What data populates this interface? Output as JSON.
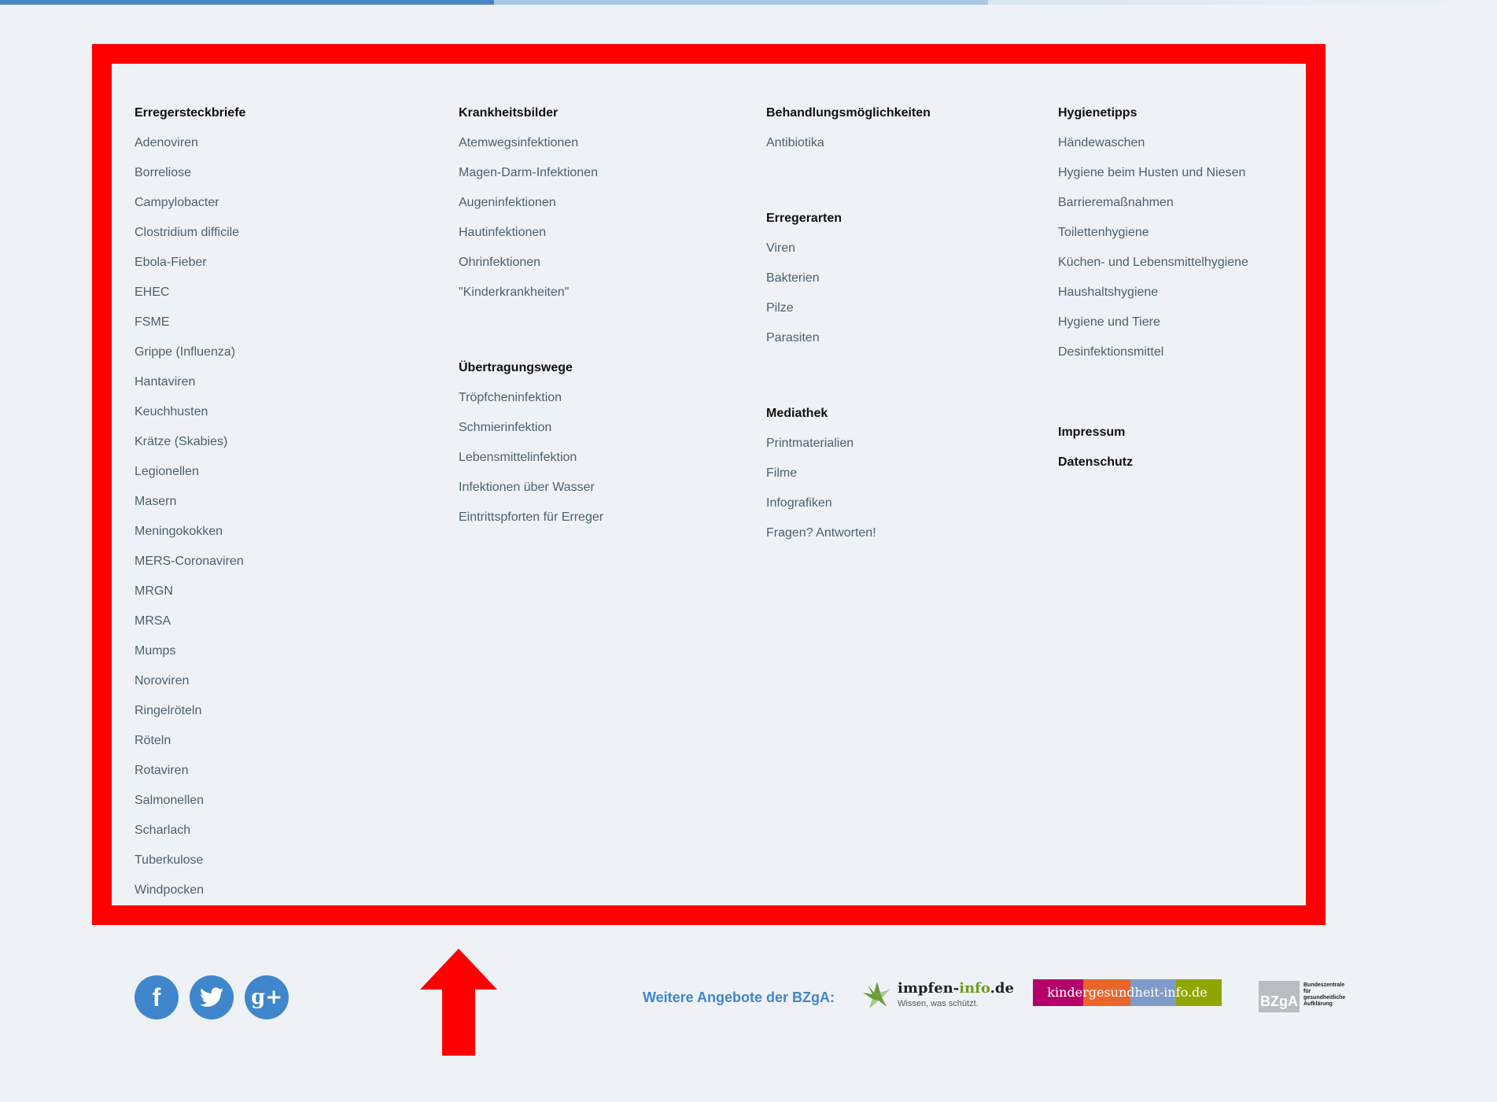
{
  "columns": [
    {
      "sections": [
        {
          "heading": "Erregersteckbriefe",
          "links": [
            "Adenoviren",
            "Borreliose",
            "Campylobacter",
            "Clostridium difficile",
            "Ebola-Fieber",
            "EHEC",
            "FSME",
            "Grippe (Influenza)",
            "Hantaviren",
            "Keuchhusten",
            "Krätze (Skabies)",
            "Legionellen",
            "Masern",
            "Meningokokken",
            "MERS-Coronaviren",
            "MRGN",
            "MRSA",
            "Mumps",
            "Noroviren",
            "Ringelröteln",
            "Röteln",
            "Rotaviren",
            "Salmonellen",
            "Scharlach",
            "Tuberkulose",
            "Windpocken"
          ]
        }
      ]
    },
    {
      "sections": [
        {
          "heading": "Krankheitsbilder",
          "links": [
            "Atemwegsinfektionen",
            "Magen-Darm-Infektionen",
            "Augeninfektionen",
            "Hautinfektionen",
            "Ohrinfektionen",
            "\"Kinderkrankheiten\""
          ]
        },
        {
          "heading": "Übertragungswege",
          "links": [
            "Tröpfcheninfektion",
            "Schmierinfektion",
            "Lebensmittelinfektion",
            "Infektionen über Wasser",
            "Eintrittspforten für Erreger"
          ]
        }
      ]
    },
    {
      "sections": [
        {
          "heading": "Behandlungsmöglichkeiten",
          "links": [
            "Antibiotika"
          ]
        },
        {
          "heading": "Erregerarten",
          "links": [
            "Viren",
            "Bakterien",
            "Pilze",
            "Parasiten"
          ]
        },
        {
          "heading": "Mediathek",
          "links": [
            "Printmaterialien",
            "Filme",
            "Infografiken",
            "Fragen? Antworten!"
          ]
        }
      ]
    },
    {
      "sections": [
        {
          "heading": "Hygienetipps",
          "links": [
            "Händewaschen",
            "Hygiene beim Husten und Niesen",
            "Barrieremaßnahmen",
            "Toilettenhygiene",
            "Küchen- und Lebensmittelhygiene",
            "Haushaltshygiene",
            "Hygiene und Tiere",
            "Desinfektionsmittel"
          ]
        }
      ],
      "bold_links": [
        "Impressum",
        "Datenschutz"
      ]
    }
  ],
  "social": {
    "facebook_glyph": "f",
    "twitter_icon": "twitter-bird-icon",
    "googleplus_glyph": "g+"
  },
  "more_offers_label": "Weitere Angebote der BZgA:",
  "partners": {
    "impfen": {
      "name_a": "impfen-",
      "name_b": "info",
      "name_c": ".de",
      "tagline": "Wissen, was schützt."
    },
    "kinder": {
      "name": "kindergesundheit-info.de",
      "colors": [
        "#b5006a",
        "#e9662b",
        "#7f9bc8",
        "#8fa600"
      ]
    },
    "bzga": {
      "abbr": "BZgA",
      "full": "Bundeszentrale für gesundheitliche Aufklärung"
    }
  },
  "colors": {
    "frame": "#ff0000",
    "accent": "#3f86cc",
    "arrow": "#ff0000"
  }
}
